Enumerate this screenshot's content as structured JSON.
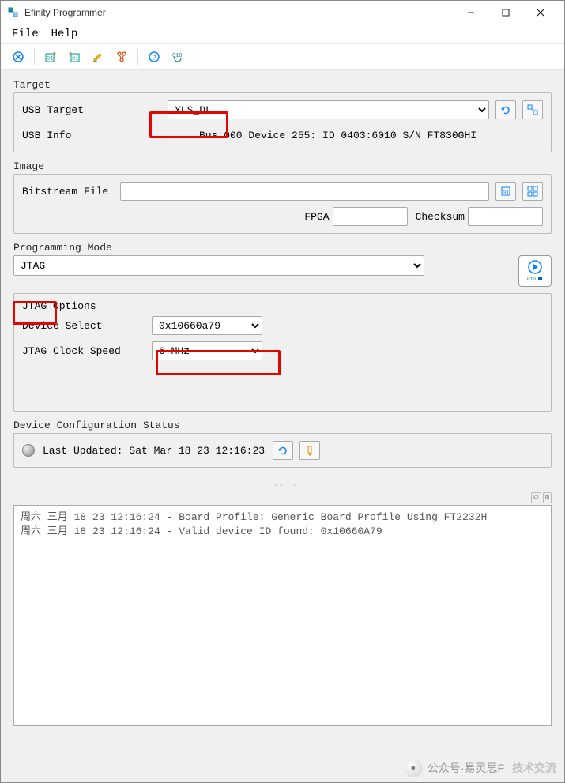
{
  "window": {
    "title": "Efinity Programmer",
    "menu": {
      "file": "File",
      "help": "Help"
    }
  },
  "sections": {
    "target": {
      "title": "Target",
      "usb_target_label": "USB Target",
      "usb_target_value": "YLS_DL",
      "usb_info_label": "USB Info",
      "usb_info_value": "Bus 000 Device 255: ID 0403:6010 S/N FT830GHI"
    },
    "image": {
      "title": "Image",
      "bitstream_label": "Bitstream File",
      "bitstream_value": "",
      "fpga_label": "FPGA",
      "fpga_value": "",
      "checksum_label": "Checksum",
      "checksum_value": ""
    },
    "progmode": {
      "title": "Programming Mode",
      "mode_value": "JTAG",
      "jtag_options_title": "JTAG Options",
      "device_select_label": "Device Select",
      "device_select_value": "0x10660a79",
      "clock_label": "JTAG Clock Speed",
      "clock_value": "6 MHz"
    },
    "status": {
      "title": "Device Configuration Status",
      "last_updated_label": "Last Updated:",
      "last_updated_value": "Sat Mar 18 23 12:16:23"
    }
  },
  "log": {
    "line1": "周六 三月 18 23 12:16:24 - Board Profile: Generic Board Profile Using FT2232H",
    "line2": "周六 三月 18 23 12:16:24 - Valid device ID found: 0x10660A79"
  },
  "watermark": {
    "label": "公众号·易灵思F",
    "label2": "技术交流"
  }
}
